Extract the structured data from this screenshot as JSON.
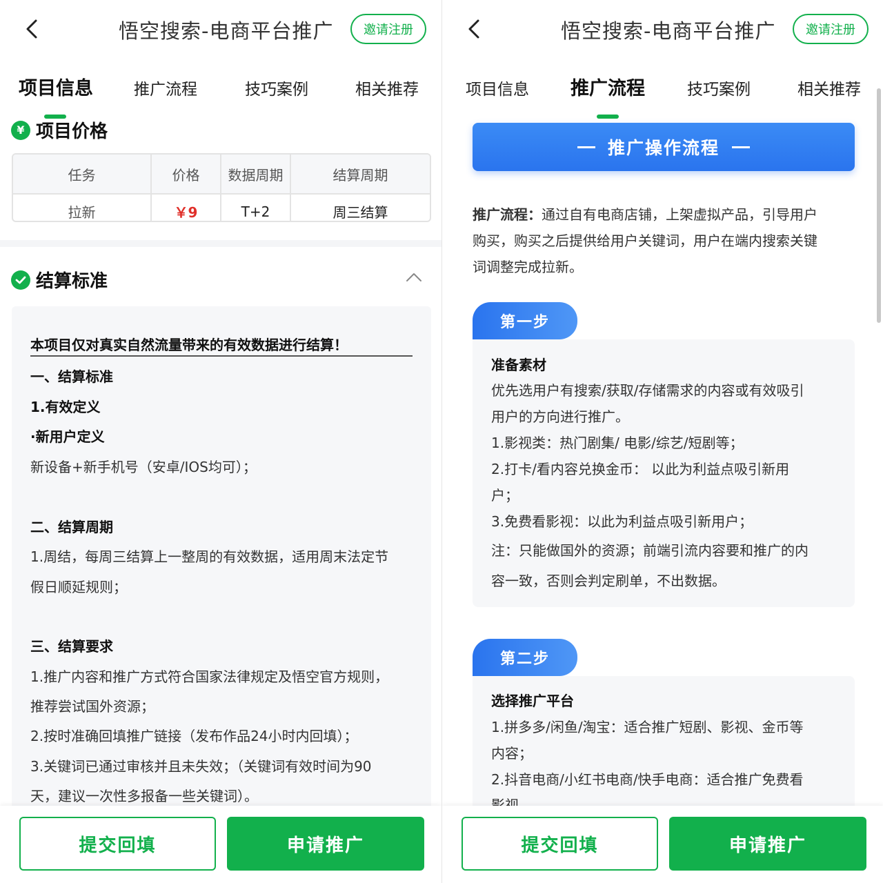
{
  "header": {
    "title": "悟空搜索-电商平台推广",
    "invite_label": "邀请注册"
  },
  "tabs": [
    "项目信息",
    "推广流程",
    "技巧案例",
    "相关推荐"
  ],
  "left": {
    "price_section_title": "项目价格",
    "price_icon": "¥",
    "price_table": {
      "headers": [
        "任务",
        "价格",
        "数据周期",
        "结算周期"
      ],
      "row": [
        "拉新",
        "￥9",
        "T+2",
        "周三结算"
      ]
    },
    "settle_section_title": "结算标准",
    "settle_lines": [
      "本项目仅对真实自然流量带来的有效数据进行结算！",
      "一、结算标准",
      "1.有效定义",
      "·新用户定义",
      "新设备+新手机号（安卓/IOS均可）；",
      "二、结算周期",
      "1.周结，每周三结算上一整周的有效数据，适用周末法定节",
      "假日顺延规则；",
      "三、结算要求",
      "1.推广内容和推广方式符合国家法律规定及悟空官方规则，",
      "推荐尝试国外资源；",
      "2.按时准确回填推广链接（发布作品24小时内回填）；",
      "3.关键词已通过审核并且未失效；（关键词有效时间为90",
      "天，建议一次性多报备一些关键词）。"
    ]
  },
  "right": {
    "banner_title": "推广操作流程",
    "intro_label": "推广流程：",
    "intro_lines": [
      "通过自有电商店铺，上架虚拟产品，引导用户",
      "购买，购买之后提供给用户关键词，用户在端内搜索关键",
      "词调整完成拉新。"
    ],
    "step1": {
      "badge": "第一步",
      "heading": "准备素材",
      "lines": [
        "优先选用户有搜索/获取/存储需求的内容或有效吸引",
        "用户的方向进行推广。",
        "1.影视类：热门剧集/ 电影/综艺/短剧等；",
        "2.打卡/看内容兑换金币： 以此为利益点吸引新用",
        "户；",
        "3.免费看影视：以此为利益点吸引新用户；",
        "注：只能做国外的资源；前端引流内容要和推广的内",
        "容一致，否则会判定刷单，不出数据。"
      ]
    },
    "step2": {
      "badge": "第二步",
      "heading": "选择推广平台",
      "lines": [
        "1.拼多多/闲鱼/淘宝：适合推广短剧、影视、金币等",
        "内容；",
        "2.抖音电商/小红书电商/快手电商：适合推广免费看",
        "影视"
      ]
    }
  },
  "bottom": {
    "submit_label": "提交回填",
    "apply_label": "申请推广"
  },
  "colors": {
    "brand_green": "#12b04c",
    "accent_blue": "#2a74ee",
    "price_red": "#e0302a"
  }
}
